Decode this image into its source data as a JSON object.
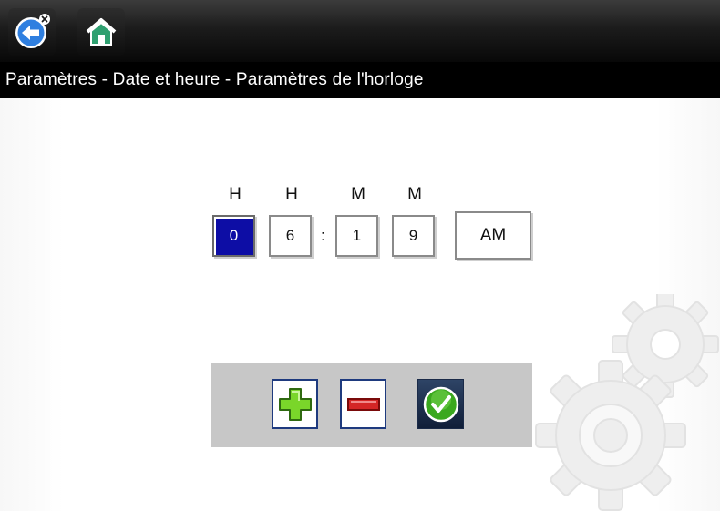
{
  "toolbar": {
    "back_icon": "back-arrow-icon",
    "home_icon": "home-icon"
  },
  "title": "Paramètres - Date et heure - Paramètres de l'horloge",
  "clock": {
    "labels": [
      "H",
      "H",
      "M",
      "M"
    ],
    "digits": [
      "0",
      "6",
      "1",
      "9"
    ],
    "separator": ":",
    "selected_digit_index": 0,
    "period": "AM"
  },
  "controls": {
    "plus_icon": "plus-icon",
    "minus_icon": "minus-icon",
    "confirm_icon": "checkmark-icon"
  },
  "colors": {
    "selected_digit_bg": "#0d0da5",
    "plus_green": "#7ad62a",
    "minus_red": "#d42626",
    "confirm_green": "#3aa81e"
  }
}
